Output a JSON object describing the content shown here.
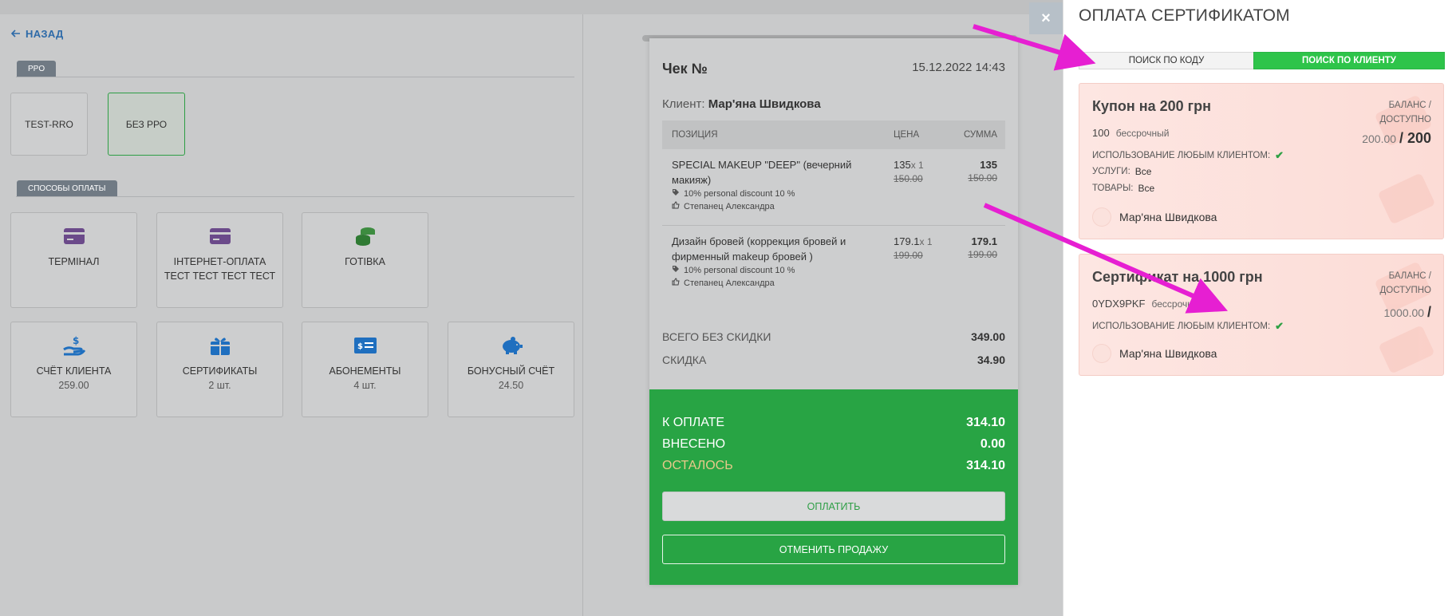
{
  "left": {
    "back_label": "НАЗАД",
    "rro_section": "PPO",
    "rro_buttons": [
      "TEST-RRO",
      "БЕЗ РРО"
    ],
    "payment_section": "СПОСОБЫ ОПЛАТЫ",
    "payment_methods": [
      {
        "label": "ТЕРМІНАЛ",
        "sub": "",
        "icon": "credit-card-icon"
      },
      {
        "label": "ІНТЕРНЕТ-ОПЛАТА ТЕСТ ТЕСТ ТЕСТ ТЕСТ",
        "sub": "",
        "icon": "credit-card-icon"
      },
      {
        "label": "ГОТІВКА",
        "sub": "",
        "icon": "coins-icon"
      },
      {
        "label": "СЧЁТ КЛИЕНТА",
        "sub": "259.00",
        "icon": "hand-dollar-icon"
      },
      {
        "label": "СЕРТИФИКАТЫ",
        "sub": "2 шт.",
        "icon": "gift-icon"
      },
      {
        "label": "АБОНЕМЕНТЫ",
        "sub": "4 шт.",
        "icon": "ticket-icon"
      },
      {
        "label": "БОНУСНЫЙ СЧЁТ",
        "sub": "24.50",
        "icon": "piggy-bank-icon"
      }
    ]
  },
  "receipt": {
    "title": "Чек №",
    "date": "15.12.2022 14:43",
    "client_label": "Клиент:",
    "client_name": "Мар'яна Швидкова",
    "columns": {
      "position": "ПОЗИЦИЯ",
      "price": "ЦЕНА",
      "sum": "СУММА"
    },
    "items": [
      {
        "name": "SPECIAL MAKEUP \"DEEP\" (вечерний макияж)",
        "discount": "10% personal discount 10 %",
        "master": "Степанец Александра",
        "price": "135",
        "qty": "x 1",
        "old_price": "150.00",
        "sum": "135",
        "old_sum": "150.00"
      },
      {
        "name": "Дизайн бровей (коррекция бровей и фирменный makeup бровей )",
        "discount": "10% personal discount 10 %",
        "master": "Степанец Александра",
        "price": "179.1",
        "qty": "x 1",
        "old_price": "199.00",
        "sum": "179.1",
        "old_sum": "199.00"
      }
    ],
    "total_no_discount_label": "ВСЕГО БЕЗ СКИДКИ",
    "total_no_discount": "349.00",
    "discount_label": "СКИДКА",
    "discount": "34.90",
    "to_pay_label": "К ОПЛАТЕ",
    "to_pay": "314.10",
    "paid_label": "ВНЕСЕНО",
    "paid": "0.00",
    "rest_label": "ОСТАЛОСЬ",
    "rest": "314.10",
    "pay_button": "ОПЛАТИТЬ",
    "cancel_button": "ОТМЕНИТЬ ПРОДАЖУ"
  },
  "panel": {
    "close": "×",
    "title": "ОПЛАТА СЕРТИФИКАТОМ",
    "tab_code": "ПОИСК ПО КОДУ",
    "tab_client": "ПОИСК ПО КЛИЕНТУ",
    "balance_label": "БАЛАНС / ДОСТУПНО",
    "certificates": [
      {
        "title": "Купон на 200 грн",
        "code": "100",
        "term": "бессрочный",
        "any_client_label": "ИСПОЛЬЗОВАНИЕ ЛЮБЫМ КЛИЕНТОМ:",
        "services_label": "УСЛУГИ:",
        "services": "Все",
        "goods_label": "ТОВАРЫ:",
        "goods": "Все",
        "balance": "200.00",
        "available": "/ 200",
        "owner": "Мар'яна Швидкова"
      },
      {
        "title": "Сертификат на 1000 грн",
        "code": "0YDX9PKF",
        "term": "бессрочный",
        "any_client_label": "ИСПОЛЬЗОВАНИЕ ЛЮБЫМ КЛИЕНТОМ:",
        "balance": "1000.00",
        "available": "/",
        "owner": "Мар'яна Швидкова"
      }
    ]
  },
  "colors": {
    "accent_green": "#28a444",
    "tab_green": "#2ec44a",
    "annotation_magenta": "#e61fd2"
  }
}
